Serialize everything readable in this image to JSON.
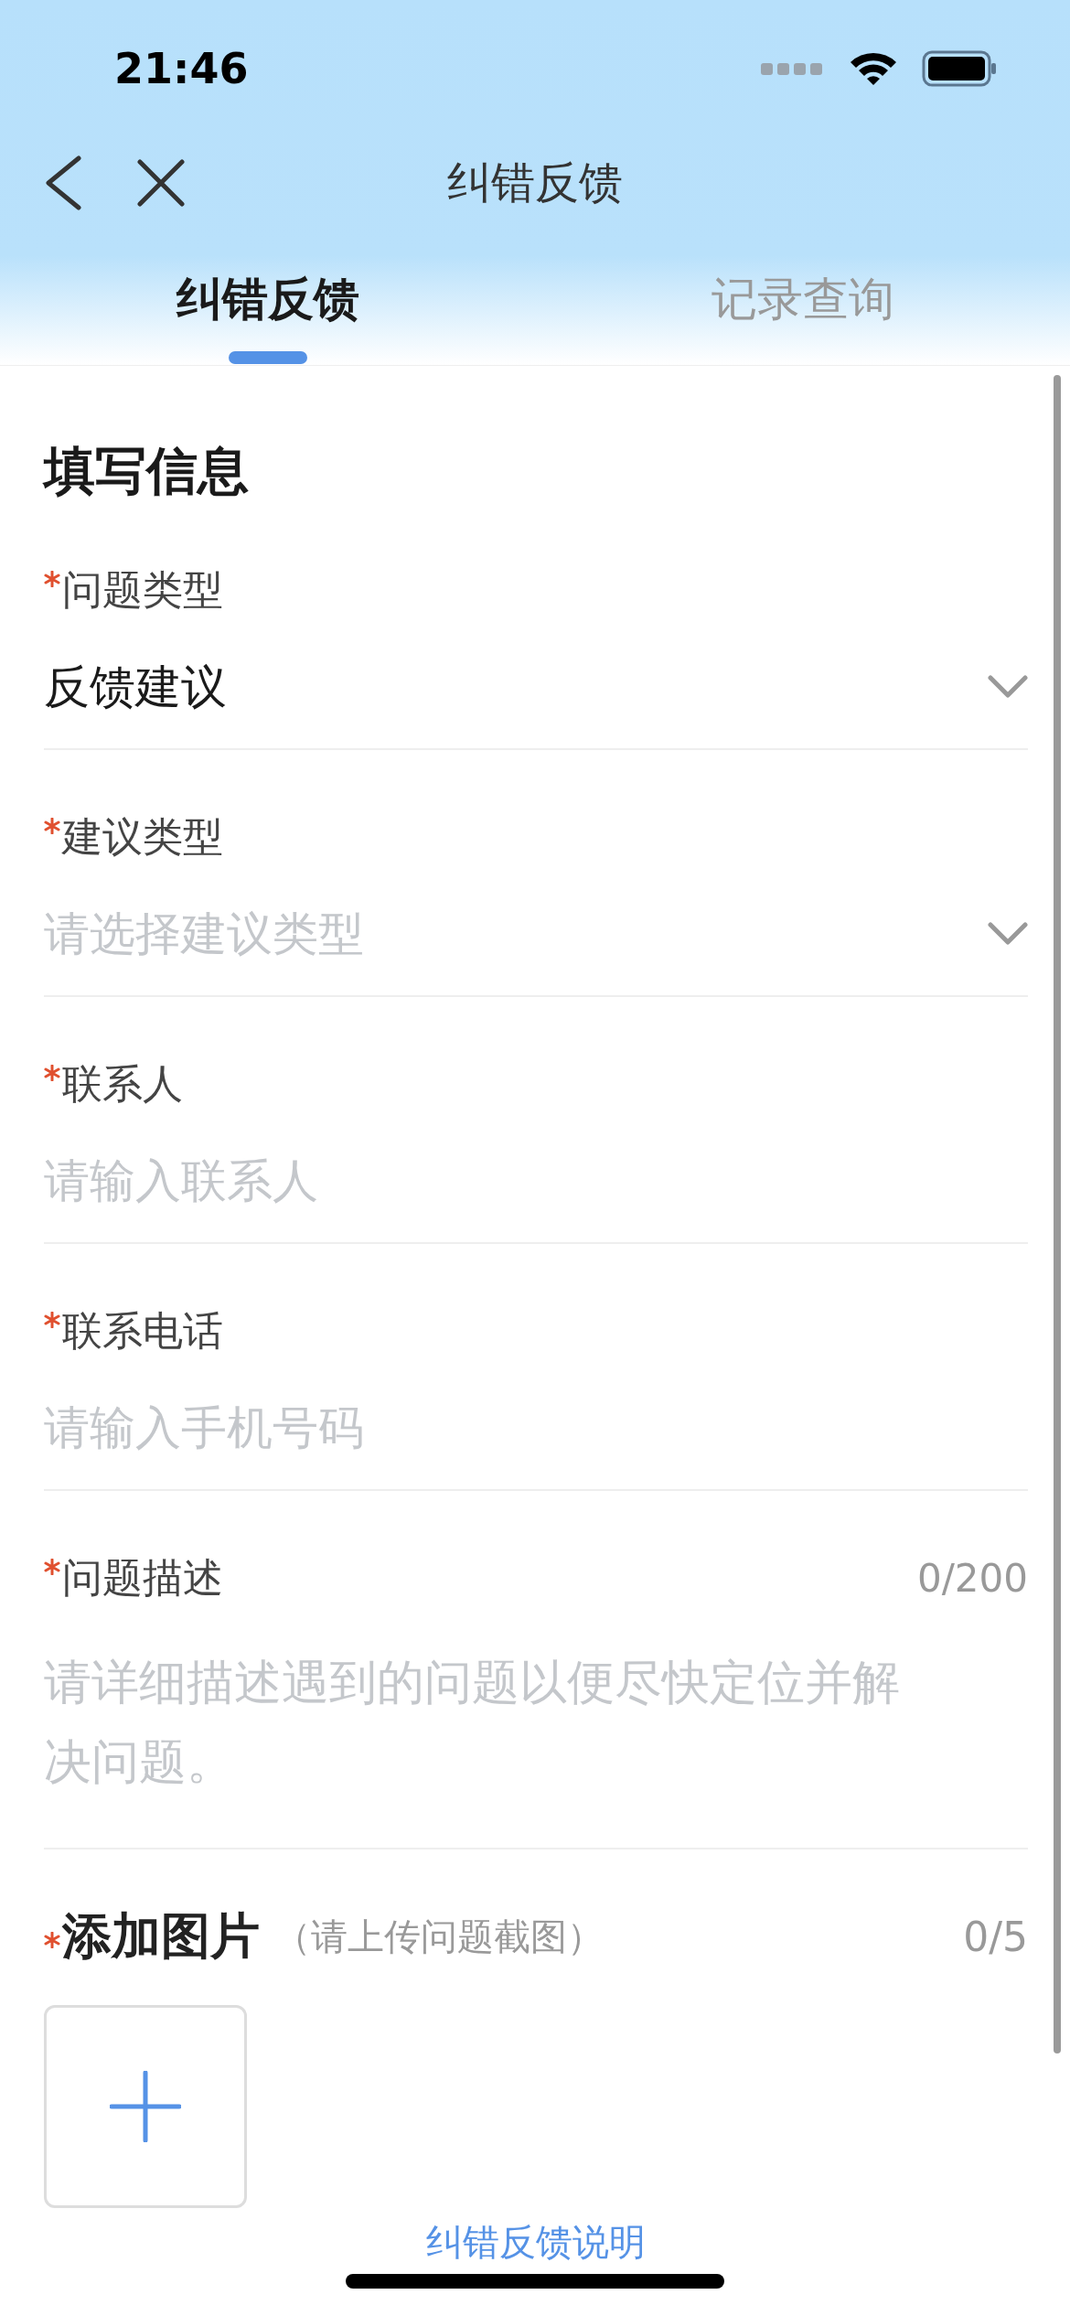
{
  "status_bar": {
    "time": "21:46"
  },
  "nav": {
    "title": "纠错反馈"
  },
  "tabs": [
    {
      "label": "纠错反馈",
      "selected": true
    },
    {
      "label": "记录查询",
      "selected": false
    }
  ],
  "form": {
    "title": "填写信息",
    "fields": [
      {
        "kind": "select",
        "label": "问题类型",
        "required": true,
        "value": "反馈建议"
      },
      {
        "kind": "select",
        "label": "建议类型",
        "required": true,
        "placeholder": "请选择建议类型"
      },
      {
        "kind": "text",
        "label": "联系人",
        "required": true,
        "placeholder": "请输入联系人"
      },
      {
        "kind": "text",
        "label": "联系电话",
        "required": true,
        "placeholder": "请输入手机号码"
      },
      {
        "kind": "textarea",
        "label": "问题描述",
        "required": true,
        "counter": "0/200",
        "placeholder": "请详细描述遇到的问题以便尽快定位并解决问题。"
      }
    ],
    "images": {
      "label": "添加图片",
      "required": true,
      "hint": "（请上传问题截图）",
      "counter": "0/5"
    }
  },
  "footer_link": "纠错反馈说明"
}
